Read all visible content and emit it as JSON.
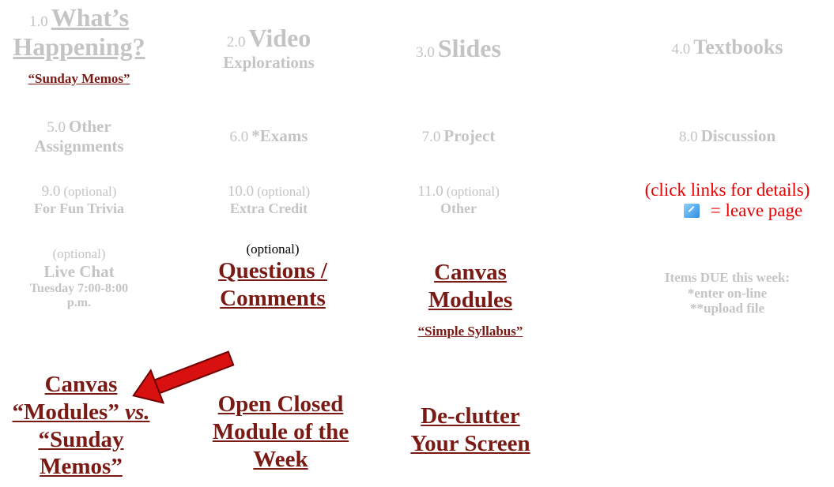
{
  "row1": {
    "c1": {
      "num": "1.0",
      "title_line1": "What’s",
      "title_line2": "Happening?",
      "sub": "“Sunday Memos”"
    },
    "c2": {
      "num": "2.0",
      "title": "Video",
      "sub": "Explorations"
    },
    "c3": {
      "num": "3.0",
      "title": "Slides"
    },
    "c4": {
      "num": "4.0",
      "title": "Textbooks"
    }
  },
  "row2": {
    "c1": {
      "num": "5.0",
      "title_line1": "Other",
      "title_line2": "Assignments"
    },
    "c2": {
      "num": "6.0",
      "title": "*Exams"
    },
    "c3": {
      "num": "7.0",
      "title": "Project"
    },
    "c4": {
      "num": "8.0",
      "title": "Discussion"
    }
  },
  "row3": {
    "c1": {
      "num": "9.0",
      "opt": "(optional)",
      "title": "For Fun Trivia"
    },
    "c2": {
      "num": "10.0",
      "opt": "(optional)",
      "title": "Extra Credit"
    },
    "c3": {
      "num": "11.0",
      "opt": "(optional)",
      "title": "Other"
    },
    "c4": {
      "line1": "(click links for details)",
      "line2": "= leave page",
      "icon": "external-link-icon"
    }
  },
  "row4": {
    "c1": {
      "opt": "(optional)",
      "title": "Live Chat",
      "time1": "Tuesday 7:00-8:00",
      "time2": "p.m."
    },
    "c2": {
      "opt": "(optional)",
      "title1": "Questions /",
      "title2": "Comments"
    },
    "c3": {
      "title1": "Canvas",
      "title2": "Modules",
      "sub": "“Simple Syllabus”"
    },
    "c4": {
      "line1": "Items DUE this week:",
      "line2": "*enter on-line",
      "line3": "**upload file"
    }
  },
  "row5": {
    "c1": {
      "l1": "Canvas",
      "l2a": "“Modules” ",
      "l2b": "vs.",
      "l3": "“Sunday",
      "l4": "Memos”"
    },
    "c2": {
      "l1": "Open Closed",
      "l2": "Module of the",
      "l3": "Week"
    },
    "c3": {
      "l1": "De-clutter",
      "l2": "Your Screen"
    }
  },
  "colors": {
    "gray": "#c4c4c4",
    "maroon": "#7a1a14",
    "red": "#e80000",
    "arrow": "#d81010"
  }
}
